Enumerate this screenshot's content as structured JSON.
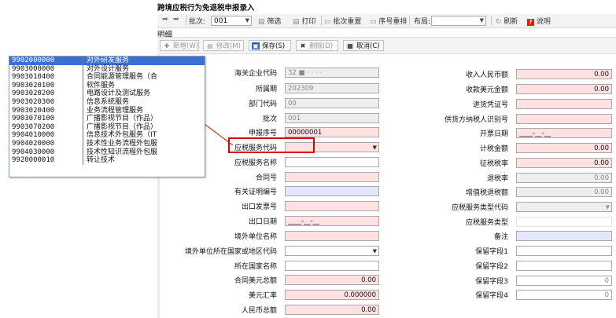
{
  "window_title": "跨境应税行为免退税申报录入",
  "toolbar1": {
    "batch_label": "批次:",
    "batch_value": "001",
    "filter_label": "筛选",
    "print_label": "打印",
    "batch_reset_label": "批次重置",
    "seq_reorder_label": "序号重排",
    "layout_label": "布局:",
    "refresh_label": "刷新",
    "help_label": "说明"
  },
  "section_label": "明细",
  "toolbar2": {
    "add_label": "新增(W)",
    "edit_label": "修改(M)",
    "save_label": "保存(S)",
    "delete_label": "删除(D)",
    "cancel_label": "取消(C)"
  },
  "form_left": {
    "enterprise_code_label": "海关企业代码",
    "enterprise_code_value": "32 ■ ·  · · ·",
    "period_label": "所属期",
    "period_value": "202309",
    "dept_code_label": "部门代码",
    "dept_code_value": "00",
    "batch_label": "批次",
    "batch_value": "001",
    "seq_label": "申报序号",
    "seq_value": "00000001",
    "service_code_label": "应税服务代码",
    "service_code_value": "",
    "service_name_label": "应税服务名称",
    "contract_no_label": "合同号",
    "cert_no_label": "有关证明编号",
    "export_invoice_label": "出口发票号",
    "export_date_label": "出口日期",
    "export_date_value": "____-__-__",
    "overseas_name_label": "境外单位名称",
    "overseas_country_code_label": "境外单位所在国家或地区代码",
    "country_name_label": "所在国家名称",
    "contract_usd_label": "合同美元总额",
    "contract_usd_value": "0.00",
    "usd_rate_label": "美元汇率",
    "usd_rate_value": "0.000000",
    "rmb_total_label": "人民币总额",
    "rmb_total_value": "0.00"
  },
  "form_right": {
    "income_rmb_label": "收入人民币额",
    "income_rmb_value": "0.00",
    "received_usd_label": "收款美元金额",
    "received_usd_value": "0.00",
    "import_voucher_label": "进货凭证号",
    "supplier_taxid_label": "供货方纳税人识别号",
    "invoice_date_label": "开票日期",
    "invoice_date_value": "____-__-__",
    "tax_basis_label": "计税金额",
    "tax_basis_value": "0.00",
    "levy_rate_label": "征税税率",
    "levy_rate_value": "0.00",
    "refund_rate_label": "退税率",
    "refund_rate_value": "0.00",
    "vat_refund_label": "增值税退税额",
    "vat_refund_value": "0.00",
    "service_type_code_label": "应税服务类型代码",
    "service_type_label": "应税服务类型",
    "remark_label": "备注",
    "reserve1_label": "保留字段1",
    "reserve2_label": "保留字段2",
    "reserve3_label": "保留字段3",
    "reserve3_value": "0",
    "reserve4_label": "保留字段4",
    "reserve4_value": "0"
  },
  "dropdown_options": [
    {
      "code": "9902000000",
      "name": "对外研发服务"
    },
    {
      "code": "9903000000",
      "name": "对外设计服务"
    },
    {
      "code": "9903010400",
      "name": "合同能源管理服务（合"
    },
    {
      "code": "9903020100",
      "name": "软件服务"
    },
    {
      "code": "9903020200",
      "name": "电路设计及测试服务"
    },
    {
      "code": "9903020300",
      "name": "信息系统服务"
    },
    {
      "code": "9903020400",
      "name": "业务流程管理服务"
    },
    {
      "code": "9903070100",
      "name": "广播影视节目（作品）"
    },
    {
      "code": "9903070200",
      "name": "广播影视节目（作品）"
    },
    {
      "code": "9904010000",
      "name": "信息技术外包服务（IT"
    },
    {
      "code": "9904020000",
      "name": "技术性业务流程外包服"
    },
    {
      "code": "9904030000",
      "name": "技术性知识流程外包服"
    },
    {
      "code": "9920000010",
      "name": "转让技术"
    }
  ]
}
